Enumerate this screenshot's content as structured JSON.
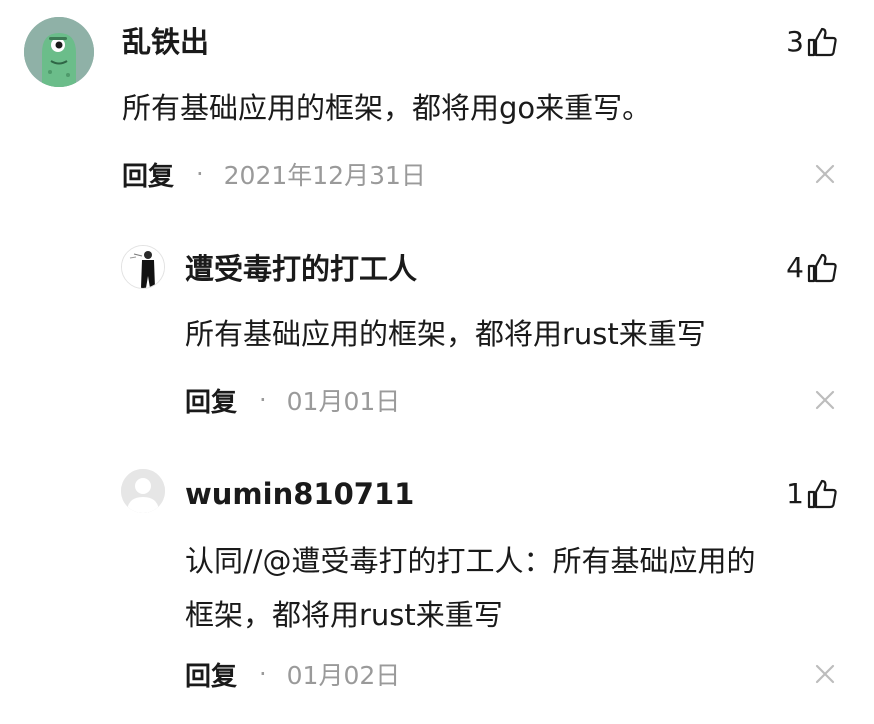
{
  "comments": [
    {
      "username": "乱铁出",
      "likes": "3",
      "content": [
        "所有基础应用的框架，都将用go来重写。"
      ],
      "reply_label": "回复",
      "separator": "·",
      "date": "2021年12月31日",
      "avatar": "green-monster-avatar"
    },
    {
      "username": "遭受毒打的打工人",
      "likes": "4",
      "content": [
        "所有基础应用的框架，都将用rust来重写"
      ],
      "reply_label": "回复",
      "separator": "·",
      "date": "01月01日",
      "avatar": "suit-figure-avatar"
    },
    {
      "username": "wumin810711",
      "likes": "1",
      "content": [
        "认同//@遭受毒打的打工人：所有基础应用的",
        "框架，都将用rust来重写"
      ],
      "reply_label": "回复",
      "separator": "·",
      "date": "01月02日",
      "avatar": "default-user-avatar"
    }
  ],
  "icons": {
    "like": "thumbs-up-icon",
    "close": "close-icon"
  },
  "colors": {
    "text": "#1a1a1a",
    "muted": "#9a9a9a",
    "close": "#bdbdbd",
    "avatar_green_bg": "#8fb1a7",
    "default_avatar_bg": "#e6e6e6"
  }
}
